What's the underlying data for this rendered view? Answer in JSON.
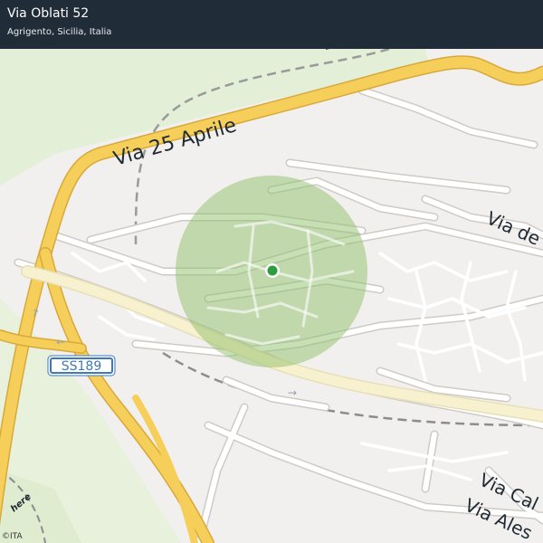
{
  "header": {
    "title": "Via Oblati 52",
    "subtitle": "Agrigento, Sicilia, Italia"
  },
  "map": {
    "road_labels": {
      "main_road": "Via 25 Aprile",
      "east_road": "Via de",
      "south_road_1": "Via Cal",
      "south_road_2": "Via Ales"
    },
    "shield_label": "SS189",
    "attribution": "©ITA",
    "logo": "here",
    "colors": {
      "header_bg": "#202c37",
      "accuracy_circle": "#8fbf6a",
      "location_dot": "#2e9d3e",
      "major_road": "#f6cf5b",
      "park": "#e3efd6",
      "shield": "#3f79b8"
    }
  }
}
